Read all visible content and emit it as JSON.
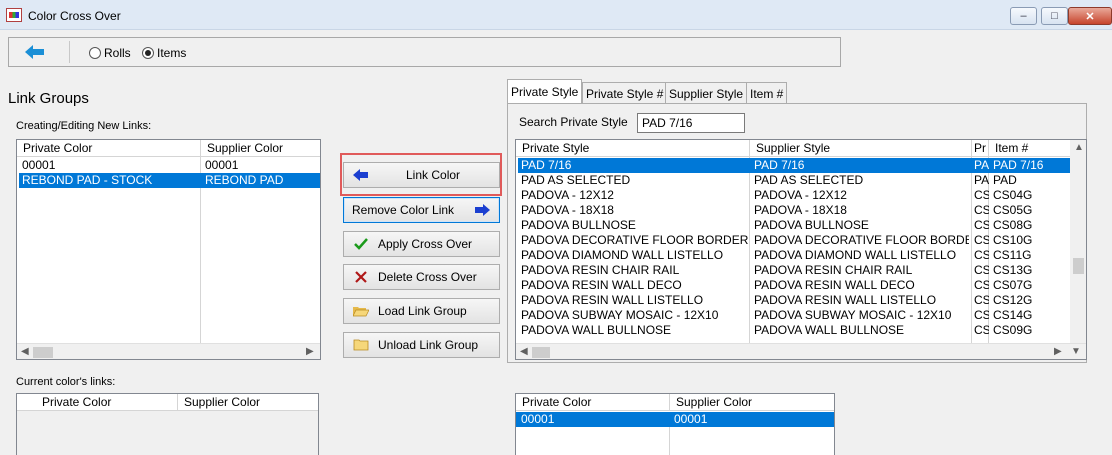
{
  "window": {
    "title": "Color Cross Over",
    "minimize_glyph": "–",
    "restore_glyph": "□",
    "close_glyph": "✕"
  },
  "toolbar": {
    "back_icon": "back-arrow-icon",
    "radio_rolls_label": "Rolls",
    "radio_items_label": "Items",
    "selected": "Items"
  },
  "link_groups": {
    "title": "Link Groups",
    "new_links_label": "Creating/Editing New Links:",
    "new_links_table": {
      "headers": [
        "Private Color",
        "Supplier Color"
      ],
      "rows": [
        [
          "00001",
          "00001"
        ],
        [
          "REBOND PAD - STOCK",
          "REBOND PAD"
        ]
      ],
      "selected_row": 1
    },
    "current_links_label": "Current color's links:",
    "current_links_table": {
      "headers": [
        "Private Color",
        "Supplier Color"
      ],
      "rows": []
    }
  },
  "actions": {
    "link_color": "Link Color",
    "remove_color_link": "Remove Color Link",
    "apply_cross_over": "Apply Cross Over",
    "delete_cross_over": "Delete Cross Over",
    "load_link_group": "Load Link Group",
    "unload_link_group": "Unload Link Group"
  },
  "tabs": [
    "Private Style",
    "Private Style #",
    "Supplier Style",
    "Item #"
  ],
  "active_tab": "Private Style",
  "search": {
    "label": "Search Private Style",
    "value": "PAD 7/16"
  },
  "style_table": {
    "headers": [
      "Private Style",
      "Supplier Style",
      "Pr",
      "Item #"
    ],
    "rows": [
      [
        "PAD 7/16",
        "PAD 7/16",
        "PA",
        "PAD 7/16"
      ],
      [
        "PAD AS SELECTED",
        "PAD AS SELECTED",
        "PA",
        "PAD"
      ],
      [
        "PADOVA - 12X12",
        "PADOVA - 12X12",
        "CS",
        "CS04G"
      ],
      [
        "PADOVA - 18X18",
        "PADOVA - 18X18",
        "CS",
        "CS05G"
      ],
      [
        "PADOVA BULLNOSE",
        "PADOVA BULLNOSE",
        "CS",
        "CS08G"
      ],
      [
        "PADOVA DECORATIVE FLOOR BORDER",
        "PADOVA DECORATIVE FLOOR BORDER",
        "CS",
        "CS10G"
      ],
      [
        "PADOVA DIAMOND WALL LISTELLO",
        "PADOVA DIAMOND WALL LISTELLO",
        "CS",
        "CS11G"
      ],
      [
        "PADOVA RESIN CHAIR RAIL",
        "PADOVA RESIN CHAIR RAIL",
        "CS",
        "CS13G"
      ],
      [
        "PADOVA RESIN WALL DECO",
        "PADOVA RESIN WALL DECO",
        "CS",
        "CS07G"
      ],
      [
        "PADOVA RESIN WALL LISTELLO",
        "PADOVA RESIN WALL LISTELLO",
        "CS",
        "CS12G"
      ],
      [
        "PADOVA SUBWAY MOSAIC - 12X10",
        "PADOVA SUBWAY MOSAIC - 12X10",
        "CS",
        "CS14G"
      ],
      [
        "PADOVA WALL BULLNOSE",
        "PADOVA WALL BULLNOSE",
        "CS",
        "CS09G"
      ]
    ],
    "selected_row": 0
  },
  "color_table": {
    "headers": [
      "Private Color",
      "Supplier Color"
    ],
    "rows": [
      [
        "00001",
        "00001"
      ]
    ],
    "selected_row": 0
  },
  "colors": {
    "selection": "#0078d7",
    "highlight_border": "#e05a5a",
    "arrow_blue": "#1b6fd0"
  }
}
